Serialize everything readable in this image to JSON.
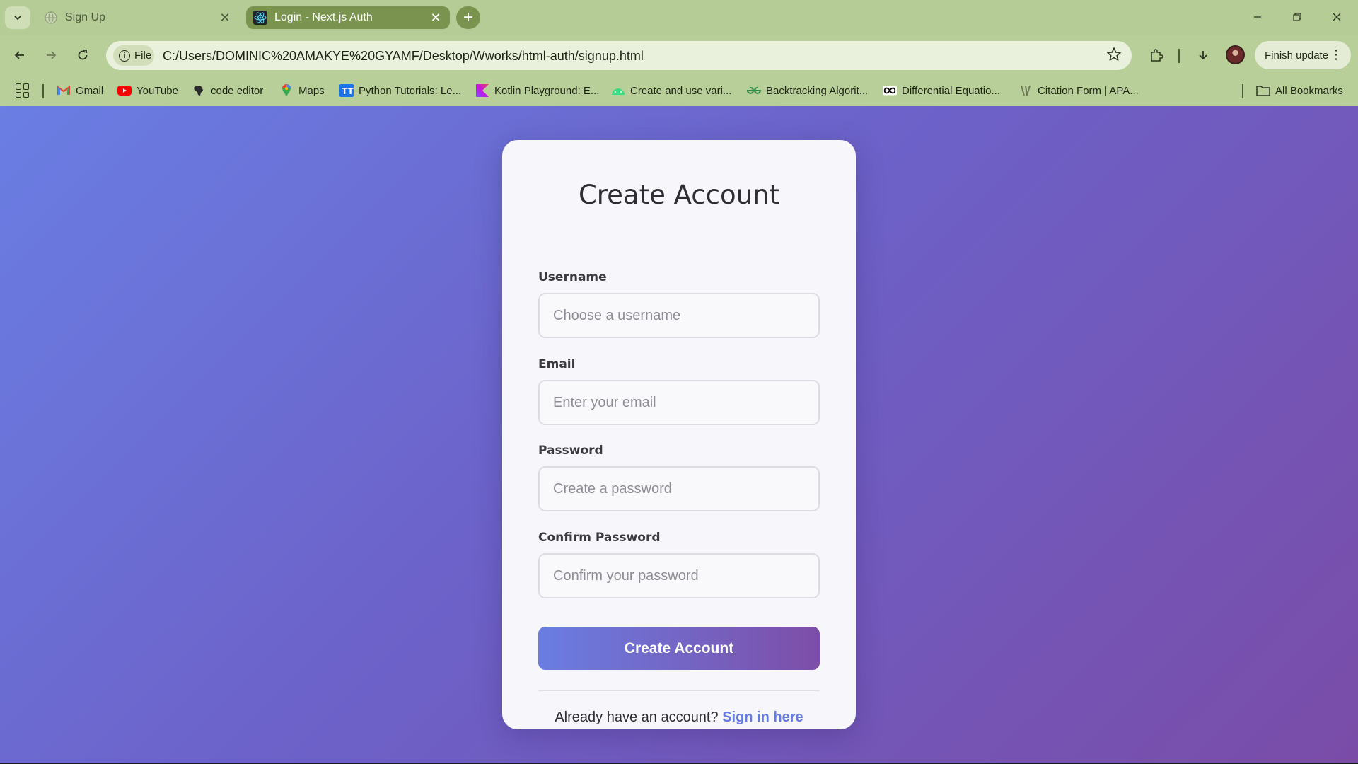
{
  "browser": {
    "tabs": [
      {
        "title": "Sign Up",
        "active": false,
        "favicon": "globe-icon"
      },
      {
        "title": "Login - Next.js Auth",
        "active": true,
        "favicon": "react-icon"
      }
    ],
    "new_tab_label": "+",
    "address": {
      "chip_label": "File",
      "url": "C:/Users/DOMINIC%20AMAKYE%20GYAMF/Desktop/Wworks/html-auth/signup.html"
    },
    "finish_update_label": "Finish update",
    "bookmarks": [
      {
        "label": "Gmail",
        "icon": "gmail-icon",
        "color": "#ea4335"
      },
      {
        "label": "YouTube",
        "icon": "youtube-icon",
        "color": "#ff0000"
      },
      {
        "label": "code editor",
        "icon": "africa-icon",
        "color": "#2b2b2b"
      },
      {
        "label": "Maps",
        "icon": "maps-pin-icon",
        "color": "#34a853"
      },
      {
        "label": "Python Tutorials: Le...",
        "icon": "tt-icon",
        "color": "#1a73e8"
      },
      {
        "label": "Kotlin Playground: E...",
        "icon": "kotlin-icon",
        "color": "#b125ea"
      },
      {
        "label": "Create and use vari...",
        "icon": "android-icon",
        "color": "#3ddc84"
      },
      {
        "label": "Backtracking Algorit...",
        "icon": "gfg-icon",
        "color": "#2f8d46"
      },
      {
        "label": "Differential Equatio...",
        "icon": "infinity-icon",
        "color": "#000000"
      },
      {
        "label": "Citation Form | APA...",
        "icon": "citation-icon",
        "color": "#6b7a55"
      }
    ],
    "all_bookmarks_label": "All Bookmarks"
  },
  "signup": {
    "title": "Create Account",
    "fields": [
      {
        "label": "Username",
        "placeholder": "Choose a username",
        "value": ""
      },
      {
        "label": "Email",
        "placeholder": "Enter your email",
        "value": ""
      },
      {
        "label": "Password",
        "placeholder": "Create a password",
        "value": ""
      },
      {
        "label": "Confirm Password",
        "placeholder": "Confirm your password",
        "value": ""
      }
    ],
    "submit_label": "Create Account",
    "footer_prompt": "Already have an account?",
    "footer_link": "Sign in here"
  },
  "colors": {
    "gradient_start": "#6a7ee3",
    "gradient_end": "#7a4ca8",
    "link": "#667be0",
    "chrome": "#b9cf99"
  }
}
